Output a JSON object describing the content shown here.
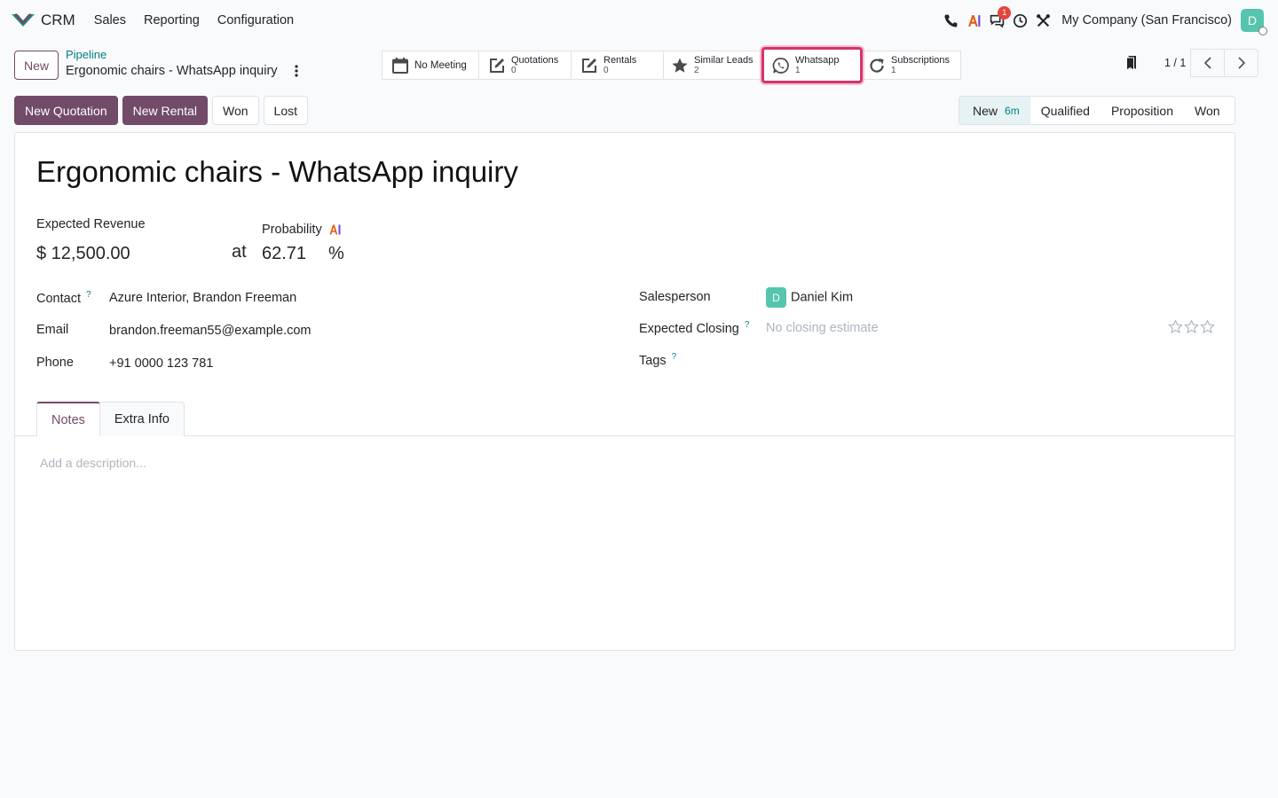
{
  "navbar": {
    "app_name": "CRM",
    "menu": [
      "Sales",
      "Reporting",
      "Configuration"
    ],
    "notification_count": "1",
    "company": "My Company (San Francisco)",
    "user_initial": "D"
  },
  "control_panel": {
    "new_label": "New",
    "breadcrumb_parent": "Pipeline",
    "breadcrumb_current": "Ergonomic chairs - WhatsApp inquiry",
    "smart_buttons": {
      "meeting": {
        "title": "No Meeting"
      },
      "quotations": {
        "title": "Quotations",
        "value": "0"
      },
      "rentals": {
        "title": "Rentals",
        "value": "0"
      },
      "similar": {
        "title": "Similar Leads",
        "value": "2"
      },
      "whatsapp": {
        "title": "Whatsapp",
        "value": "1"
      },
      "subscriptions": {
        "title": "Subscriptions",
        "value": "1"
      }
    },
    "pager": "1 / 1"
  },
  "statusbar": {
    "buttons": {
      "new_quotation": "New Quotation",
      "new_rental": "New Rental",
      "won": "Won",
      "lost": "Lost"
    },
    "stages": {
      "new": "New",
      "new_duration": "6m",
      "qualified": "Qualified",
      "proposition": "Proposition",
      "won": "Won"
    }
  },
  "form": {
    "title": "Ergonomic chairs - WhatsApp inquiry",
    "expected_revenue_label": "Expected Revenue",
    "expected_revenue": "$ 12,500.00",
    "at": "at",
    "probability_label": "Probability",
    "probability": "62.71",
    "percent": "%",
    "contact_label": "Contact",
    "contact": "Azure Interior, Brandon Freeman",
    "email_label": "Email",
    "email": "brandon.freeman55@example.com",
    "phone_label": "Phone",
    "phone": "+91 0000 123 781",
    "salesperson_label": "Salesperson",
    "salesperson": "Daniel Kim",
    "salesperson_initial": "D",
    "closing_label": "Expected Closing",
    "closing_placeholder": "No closing estimate",
    "tags_label": "Tags",
    "help_mark": "?",
    "priority_stars": 0,
    "tabs": {
      "notes": "Notes",
      "extra": "Extra Info"
    },
    "description_placeholder": "Add a description..."
  },
  "colors": {
    "brand": "#714b67",
    "link": "#017e84",
    "highlight": "#d6336c"
  }
}
